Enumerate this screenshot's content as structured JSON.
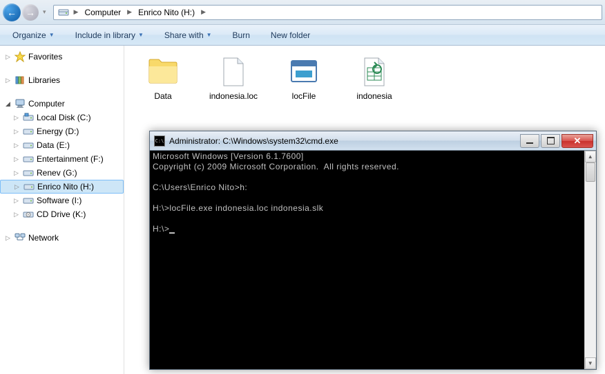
{
  "nav": {
    "breadcrumb": [
      "Computer",
      "Enrico Nito (H:)"
    ]
  },
  "toolbar": {
    "organize": "Organize",
    "include": "Include in library",
    "share": "Share with",
    "burn": "Burn",
    "newfolder": "New folder"
  },
  "sidebar": {
    "favorites": "Favorites",
    "libraries": "Libraries",
    "computer": "Computer",
    "drives": [
      "Local Disk (C:)",
      "Energy (D:)",
      "Data (E:)",
      "Entertainment (F:)",
      "Renev (G:)",
      "Enrico Nito (H:)",
      "Software (I:)",
      "CD Drive (K:)"
    ],
    "network": "Network"
  },
  "files": {
    "items": [
      "Data",
      "indonesia.loc",
      "locFile",
      "indonesia"
    ]
  },
  "cmd": {
    "title": "Administrator: C:\\Windows\\system32\\cmd.exe",
    "icon_text": "C:\\",
    "lines": [
      "Microsoft Windows [Version 6.1.7600]",
      "Copyright (c) 2009 Microsoft Corporation.  All rights reserved.",
      "",
      "C:\\Users\\Enrico Nito>h:",
      "",
      "H:\\>locFile.exe indonesia.loc indonesia.slk",
      "",
      "H:\\>"
    ]
  }
}
